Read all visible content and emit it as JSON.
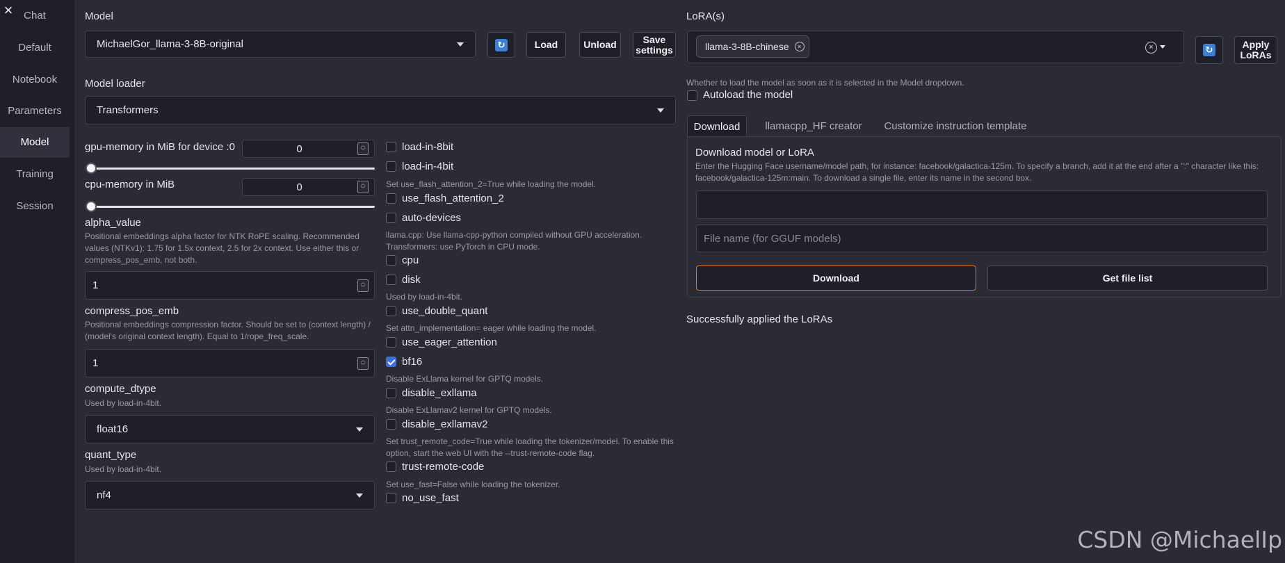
{
  "sidebar": {
    "close_symbol": "×",
    "items": [
      {
        "label": "Chat"
      },
      {
        "label": "Default"
      },
      {
        "label": "Notebook"
      },
      {
        "label": "Parameters"
      },
      {
        "label": "Model",
        "active": true
      },
      {
        "label": "Training"
      },
      {
        "label": "Session"
      }
    ]
  },
  "model": {
    "label": "Model",
    "selected": "MichaelGor_llama-3-8B-original",
    "load": "Load",
    "unload": "Unload",
    "save_line1": "Save",
    "save_line2": "settings",
    "refresh_icon": "refresh-icon"
  },
  "loader": {
    "label": "Model loader",
    "selected": "Transformers"
  },
  "gpu_memory": {
    "label": "gpu-memory in MiB for device :0",
    "value": "0",
    "slider_level": 0
  },
  "cpu_memory": {
    "label": "cpu-memory in MiB",
    "value": "0",
    "slider_level": 0
  },
  "alpha": {
    "label": "alpha_value",
    "info": "Positional embeddings alpha factor for NTK RoPE scaling. Recommended values (NTKv1): 1.75 for 1.5x context, 2.5 for 2x context. Use either this or compress_pos_emb, not both.",
    "value": "1"
  },
  "compress": {
    "label": "compress_pos_emb",
    "info": "Positional embeddings compression factor. Should be set to (context length) / (model's original context length). Equal to 1/rope_freq_scale.",
    "value": "1"
  },
  "compute_dtype": {
    "label": "compute_dtype",
    "info": "Used by load-in-4bit.",
    "selected": "float16"
  },
  "quant_type": {
    "label": "quant_type",
    "info": "Used by load-in-4bit.",
    "selected": "nf4"
  },
  "options": {
    "load_in_8bit": "load-in-8bit",
    "load_in_4bit": "load-in-4bit",
    "flash_info": "Set use_flash_attention_2=True while loading the model.",
    "use_flash": "use_flash_attention_2",
    "auto_devices": "auto-devices",
    "cpu_info": "llama.cpp: Use llama-cpp-python compiled without GPU acceleration. Transformers: use PyTorch in CPU mode.",
    "cpu": "cpu",
    "disk": "disk",
    "double_info": "Used by load-in-4bit.",
    "double_quant": "use_double_quant",
    "eager_info": "Set attn_implementation= eager while loading the model.",
    "eager": "use_eager_attention",
    "bf16": "bf16",
    "exllama_info": "Disable ExLlama kernel for GPTQ models.",
    "exllama": "disable_exllama",
    "exllamav2_info": "Disable ExLlamav2 kernel for GPTQ models.",
    "exllamav2": "disable_exllamav2",
    "trust_info": "Set trust_remote_code=True while loading the tokenizer/model. To enable this option, start the web UI with the --trust-remote-code flag.",
    "trust": "trust-remote-code",
    "fast_info": "Set use_fast=False while loading the tokenizer.",
    "no_fast": "no_use_fast"
  },
  "lora": {
    "label": "LoRA(s)",
    "chip": "llama-3-8B-chinese",
    "apply_line1": "Apply",
    "apply_line2": "LoRAs",
    "clear_symbol": "×",
    "remove_symbol": "×"
  },
  "autoload": {
    "info": "Whether to load the model as soon as it is selected in the Model dropdown.",
    "label": "Autoload the model"
  },
  "tabs": [
    {
      "label": "Download"
    },
    {
      "label": "llamacpp_HF creator"
    },
    {
      "label": "Customize instruction template"
    }
  ],
  "download": {
    "title": "Download model or LoRA",
    "info": "Enter the Hugging Face username/model path, for instance: facebook/galactica-125m. To specify a branch, add it at the end after a \":\" character like this: facebook/galactica-125m:main. To download a single file, enter its name in the second box.",
    "file_placeholder": "File name (for GGUF models)",
    "download_button": "Download",
    "file_list_button": "Get file list"
  },
  "status": "Successfully applied the LoRAs",
  "watermark": "CSDN @MichaelIp",
  "colors": {
    "accent": "#3b6fe0",
    "download_border": "#e07b2e",
    "background": "#2b2b36"
  }
}
